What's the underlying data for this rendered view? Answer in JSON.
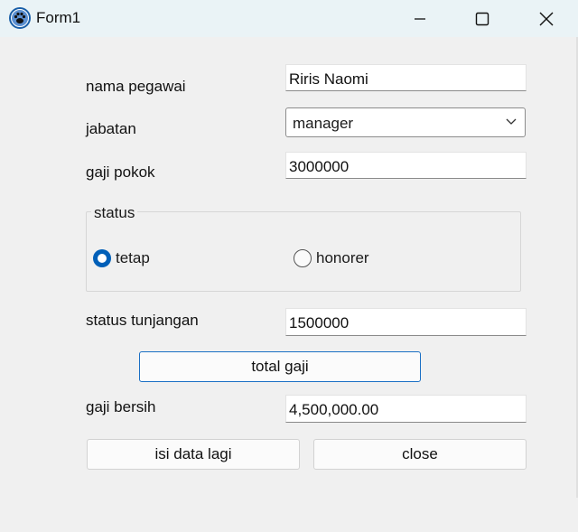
{
  "window": {
    "title": "Form1"
  },
  "icons": {
    "app": "paw-icon",
    "minimize": "minimize-icon",
    "maximize": "maximize-icon",
    "close": "close-icon",
    "dropdown": "chevron-down-icon"
  },
  "form": {
    "nama_label": "nama pegawai",
    "nama_value": "Riris Naomi",
    "jabatan_label": "jabatan",
    "jabatan_value": "manager",
    "gaji_pokok_label": "gaji pokok",
    "gaji_pokok_value": "3000000",
    "status_group_label": "status",
    "status_options": [
      {
        "label": "tetap",
        "selected": true
      },
      {
        "label": "honorer",
        "selected": false
      }
    ],
    "tunjangan_label": "status tunjangan",
    "tunjangan_value": "1500000",
    "total_button": "total gaji",
    "gaji_bersih_label": "gaji bersih",
    "gaji_bersih_value": "4,500,000.00",
    "isi_button": "isi data lagi",
    "close_button": "close"
  },
  "colors": {
    "accent": "#005fb8",
    "titlebar": "#eaf3f6",
    "background": "#f0f0f0"
  }
}
